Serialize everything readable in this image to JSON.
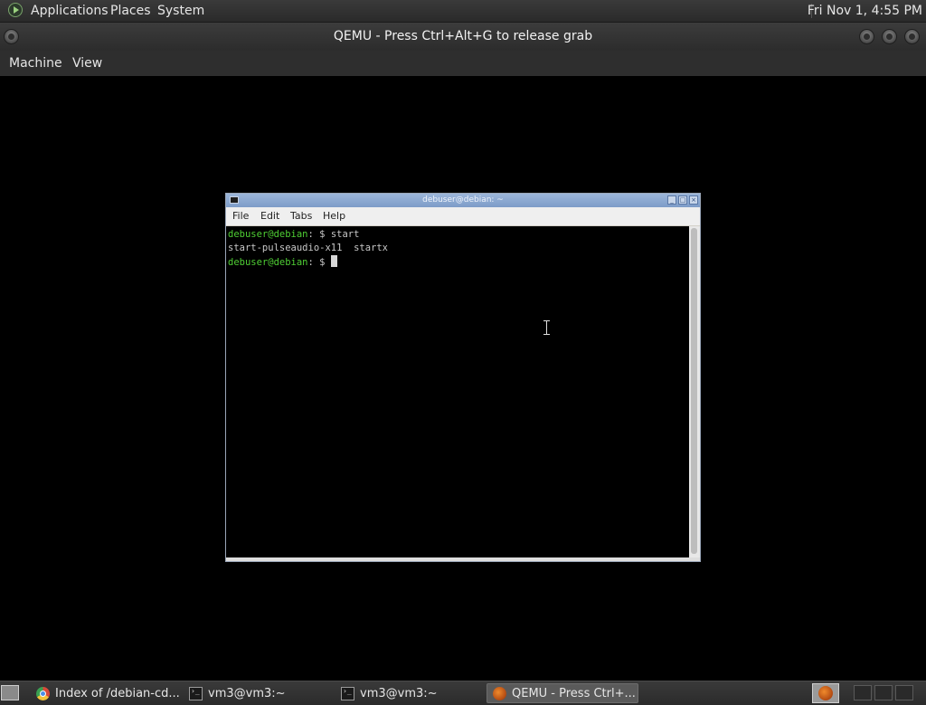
{
  "top_panel": {
    "menus": [
      "Applications",
      "Places",
      "System"
    ],
    "clock": "Fri Nov  1,  4:55 PM"
  },
  "qemu_window": {
    "title": "QEMU - Press Ctrl+Alt+G to release grab",
    "menus": [
      "Machine",
      "View"
    ]
  },
  "guest_terminal": {
    "title": "debuser@debian: ~",
    "menus": [
      "File",
      "Edit",
      "Tabs",
      "Help"
    ],
    "lines": [
      {
        "user_host": "debuser@debian",
        "path_prompt": ": $ ",
        "command": "start"
      },
      {
        "output": "start-pulseaudio-x11  startx"
      },
      {
        "user_host": "debuser@debian",
        "path_prompt": ": $ ",
        "command": ""
      }
    ]
  },
  "taskbar": {
    "tasks": [
      {
        "label": "Index of /debian-cd...",
        "icon": "chrome-icon",
        "active": false
      },
      {
        "label": "vm3@vm3:~",
        "icon": "terminal-icon",
        "active": false
      },
      {
        "label": "vm3@vm3:~",
        "icon": "terminal-icon",
        "active": false
      },
      {
        "label": "QEMU - Press Ctrl+...",
        "icon": "qemu-icon",
        "active": true
      }
    ]
  },
  "colors": {
    "prompt_green": "#4fcf34",
    "panel_bg": "#2e2e2e",
    "terminal_titlebar": "#7d9cc8"
  }
}
